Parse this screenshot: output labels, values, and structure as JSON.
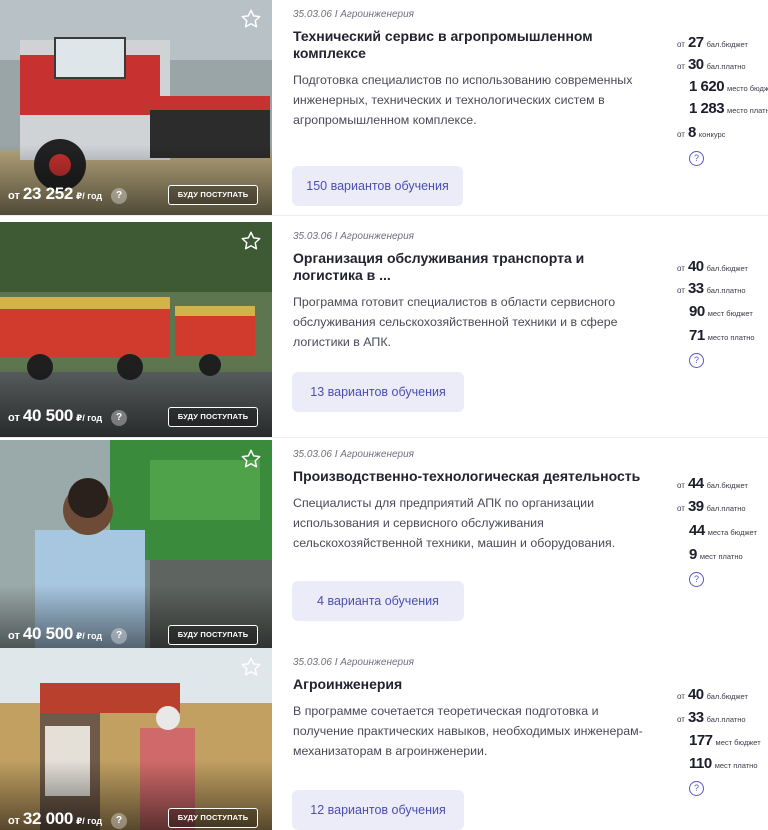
{
  "colors": {
    "accent": "#4b4eb0",
    "button_bg": "#ececf8"
  },
  "cards": [
    {
      "meta": "35.03.06 I Агроинженерия",
      "title": "Технический сервис в агропромышленном комплексе",
      "description": "Подготовка специалистов по использованию современных инженерных, технических и технологических систем в агропромышленном комплексе.",
      "variants": "150 вариантов обучения",
      "price_prefix": "от",
      "price": "23 252",
      "price_unit": "₽/ год",
      "help": "?",
      "apply": "БУДУ ПОСТУПАТЬ",
      "stats": [
        {
          "prefix": "от",
          "value": "27",
          "label": "бал.бюджет"
        },
        {
          "prefix": "от",
          "value": "30",
          "label": "бал.платно"
        },
        {
          "prefix": "",
          "value": "1 620",
          "label": "место бюджет"
        },
        {
          "prefix": "",
          "value": "1 283",
          "label": "место платно"
        },
        {
          "prefix": "от",
          "value": "8",
          "label": "конкурс"
        }
      ]
    },
    {
      "meta": "35.03.06 I Агроинженерия",
      "title": "Организация обслуживания транспорта и логистика в ...",
      "description": "Программа готовит специалистов в области сервисного обслуживания сельскохозяйственной техники и в сфере логистики в АПК.",
      "variants": "13 вариантов обучения",
      "price_prefix": "от",
      "price": "40 500",
      "price_unit": "₽/ год",
      "help": "?",
      "apply": "БУДУ ПОСТУПАТЬ",
      "stats": [
        {
          "prefix": "от",
          "value": "40",
          "label": "бал.бюджет"
        },
        {
          "prefix": "от",
          "value": "33",
          "label": "бал.платно"
        },
        {
          "prefix": "",
          "value": "90",
          "label": "мест бюджет"
        },
        {
          "prefix": "",
          "value": "71",
          "label": "место платно"
        }
      ]
    },
    {
      "meta": "35.03.06 I Агроинженерия",
      "title": "Производственно-технологическая деятельность",
      "description": "Специалисты для предприятий АПК по организации использования и сервисного обслуживания сельскохозяйственной техники, машин и оборудования.",
      "variants": "4 варианта обучения",
      "price_prefix": "от",
      "price": "40 500",
      "price_unit": "₽/ год",
      "help": "?",
      "apply": "БУДУ ПОСТУПАТЬ",
      "stats": [
        {
          "prefix": "от",
          "value": "44",
          "label": "бал.бюджет"
        },
        {
          "prefix": "от",
          "value": "39",
          "label": "бал.платно"
        },
        {
          "prefix": "",
          "value": "44",
          "label": "места бюджет"
        },
        {
          "prefix": "",
          "value": "9",
          "label": "мест платно"
        }
      ]
    },
    {
      "meta": "35.03.06 I Агроинженерия",
      "title": "Агроинженерия",
      "description": "В программе сочетается теоретическая подготовка и получение практических навыков, необходимых инженерам-механизаторам в агроинженерии.",
      "variants": "12 вариантов обучения",
      "price_prefix": "от",
      "price": "32 000",
      "price_unit": "₽/ год",
      "help": "?",
      "apply": "БУДУ ПОСТУПАТЬ",
      "stats": [
        {
          "prefix": "от",
          "value": "40",
          "label": "бал.бюджет"
        },
        {
          "prefix": "от",
          "value": "33",
          "label": "бал.платно"
        },
        {
          "prefix": "",
          "value": "177",
          "label": "мест бюджет"
        },
        {
          "prefix": "",
          "value": "110",
          "label": "мест платно"
        }
      ]
    }
  ]
}
